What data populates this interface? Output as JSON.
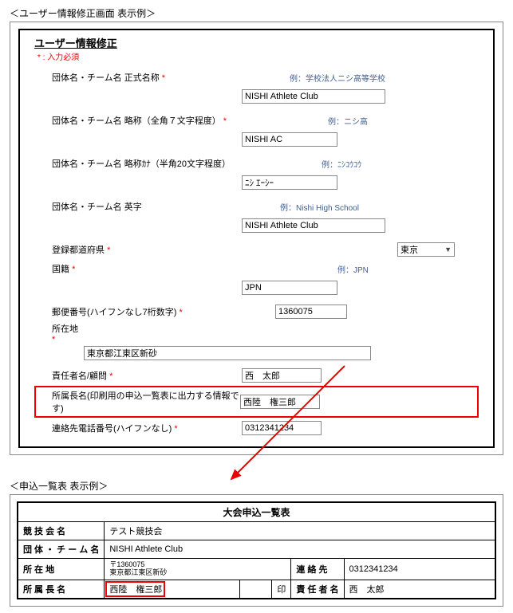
{
  "sections": {
    "user_edit_caption": "＜ユーザー情報修正画面 表示例＞",
    "entry_list_caption": "＜申込一覧表 表示例＞"
  },
  "form": {
    "title": "ユーザー情報修正",
    "required_note": "* : 入力必須",
    "fields": {
      "org_name_label": "団体名・チーム名 正式名称",
      "org_name_example": "例：学校法人ニシ高等学校",
      "org_name_value": "NISHI Athlete Club",
      "abbr_label": "団体名・チーム名 略称（全角７文字程度）",
      "abbr_example": "例：ニシ高",
      "abbr_value": "NISHI AC",
      "abbr_kana_label": "団体名・チーム名 略称ｶﾅ（半角20文字程度）",
      "abbr_kana_example": "例：ﾆｼｺｳｺｳ",
      "abbr_kana_value": "ﾆｼ ｴｰｼｰ",
      "eng_label": "団体名・チーム名 英字",
      "eng_example": "例：Nishi High School",
      "eng_value": "NISHI Athlete Club",
      "pref_label": "登録都道府県",
      "pref_value": "東京",
      "nat_label": "国籍",
      "nat_example": "例：JPN",
      "nat_value": "JPN",
      "zip_label": "郵便番号(ハイフンなし7桁数字)",
      "zip_value": "1360075",
      "address_label": "所在地",
      "address_value": "東京都江東区新砂",
      "manager_label": "責任者名/顧問",
      "manager_value": "西　太郎",
      "head_label": "所属長名(印刷用の申込一覧表に出力する情報です)",
      "head_value": "西陸　権三郎",
      "tel_label": "連絡先電話番号(ハイフンなし)",
      "tel_value": "0312341234"
    },
    "asterisk": "*"
  },
  "app_list": {
    "title": "大会申込一覧表",
    "labels": {
      "meet": "競 技 会 名",
      "team": "団 体 ・ チ ー ム 名",
      "address": "所 在 地",
      "contact": "連 絡 先",
      "head": "所 属 長 名",
      "manager": "責 任 者 名",
      "seal": "印"
    },
    "values": {
      "meet": "テスト競技会",
      "team": "NISHI Athlete Club",
      "zip_line": "〒1360075",
      "addr_line": "東京都江東区新砂",
      "contact": "0312341234",
      "head": "西陸　権三郎",
      "manager": "西　太郎"
    }
  }
}
